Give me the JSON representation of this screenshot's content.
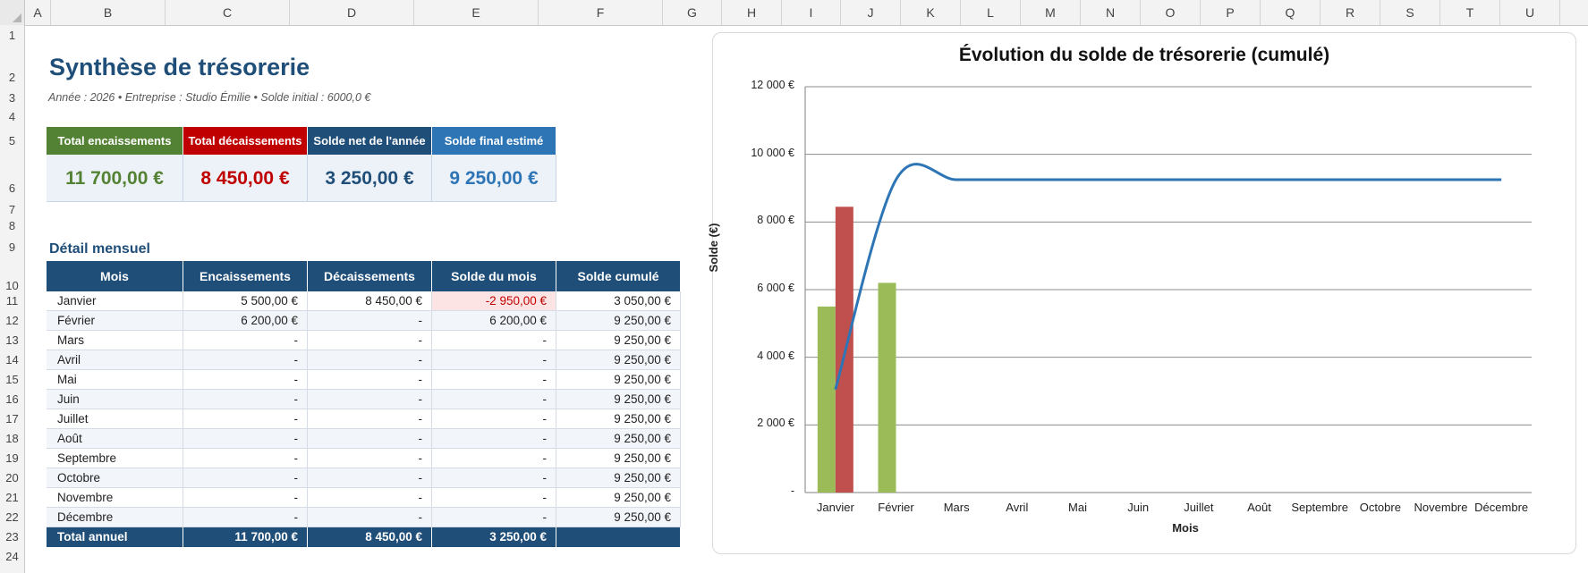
{
  "sheet": {
    "columns": [
      "A",
      "B",
      "C",
      "D",
      "E",
      "F",
      "G",
      "H",
      "I",
      "J",
      "K",
      "L",
      "M",
      "N",
      "O",
      "P",
      "Q",
      "R",
      "S",
      "T",
      "U"
    ],
    "rows": [
      "1",
      "2",
      "3",
      "4",
      "5",
      "6",
      "7",
      "8",
      "9",
      "10",
      "11",
      "12",
      "13",
      "14",
      "15",
      "16",
      "17",
      "18",
      "19",
      "20",
      "21",
      "22",
      "23",
      "24"
    ]
  },
  "header": {
    "title": "Synthèse de trésorerie",
    "subtitle": "Année : 2026  •  Entreprise : Studio Émilie  •  Solde initial : 6000,0 €"
  },
  "kpis": [
    {
      "label": "Total encaissements",
      "value": "11 700,00 €",
      "header_color": "#548235",
      "value_color": "#548235"
    },
    {
      "label": "Total décaissements",
      "value": "8 450,00 €",
      "header_color": "#c00000",
      "value_color": "#c00000"
    },
    {
      "label": "Solde net de l'année",
      "value": "3 250,00 €",
      "header_color": "#1f4e79",
      "value_color": "#1f4e79"
    },
    {
      "label": "Solde final estimé",
      "value": "9 250,00 €",
      "header_color": "#2e75b6",
      "value_color": "#2e75b6"
    }
  ],
  "section_title": "Détail mensuel",
  "table": {
    "headers": [
      "Mois",
      "Encaissements",
      "Décaissements",
      "Solde du mois",
      "Solde cumulé"
    ],
    "rows": [
      [
        "Janvier",
        "5 500,00 €",
        "8 450,00 €",
        "-2 950,00 €",
        "3 050,00 €"
      ],
      [
        "Février",
        "6 200,00 €",
        "-",
        "6 200,00 €",
        "9 250,00 €"
      ],
      [
        "Mars",
        "-",
        "-",
        "-",
        "9 250,00 €"
      ],
      [
        "Avril",
        "-",
        "-",
        "-",
        "9 250,00 €"
      ],
      [
        "Mai",
        "-",
        "-",
        "-",
        "9 250,00 €"
      ],
      [
        "Juin",
        "-",
        "-",
        "-",
        "9 250,00 €"
      ],
      [
        "Juillet",
        "-",
        "-",
        "-",
        "9 250,00 €"
      ],
      [
        "Août",
        "-",
        "-",
        "-",
        "9 250,00 €"
      ],
      [
        "Septembre",
        "-",
        "-",
        "-",
        "9 250,00 €"
      ],
      [
        "Octobre",
        "-",
        "-",
        "-",
        "9 250,00 €"
      ],
      [
        "Novembre",
        "-",
        "-",
        "-",
        "9 250,00 €"
      ],
      [
        "Décembre",
        "-",
        "-",
        "-",
        "9 250,00 €"
      ]
    ],
    "total": [
      "Total annuel",
      "11 700,00 €",
      "8 450,00 €",
      "3 250,00 €",
      ""
    ]
  },
  "chart_data": {
    "type": "bar",
    "title": "Évolution du solde de trésorerie (cumulé)",
    "xlabel": "Mois",
    "ylabel": "Solde (€)",
    "categories": [
      "Janvier",
      "Février",
      "Mars",
      "Avril",
      "Mai",
      "Juin",
      "Juillet",
      "Août",
      "Septembre",
      "Octobre",
      "Novembre",
      "Décembre"
    ],
    "ylim": [
      0,
      12000
    ],
    "yticks": [
      0,
      2000,
      4000,
      6000,
      8000,
      10000,
      12000
    ],
    "ytick_labels": [
      "-",
      "2 000 €",
      "4 000 €",
      "6 000 €",
      "8 000 €",
      "10 000 €",
      "12 000 €"
    ],
    "grid": true,
    "series": [
      {
        "type": "bar",
        "color": "#9bbb59",
        "values": [
          5500,
          6200,
          0,
          0,
          0,
          0,
          0,
          0,
          0,
          0,
          0,
          0
        ]
      },
      {
        "type": "bar",
        "color": "#c0504d",
        "values": [
          8450,
          0,
          0,
          0,
          0,
          0,
          0,
          0,
          0,
          0,
          0,
          0
        ]
      },
      {
        "type": "line",
        "color": "#2e75b6",
        "values": [
          3050,
          9250,
          9250,
          9250,
          9250,
          9250,
          9250,
          9250,
          9250,
          9250,
          9250,
          9250
        ]
      }
    ]
  }
}
